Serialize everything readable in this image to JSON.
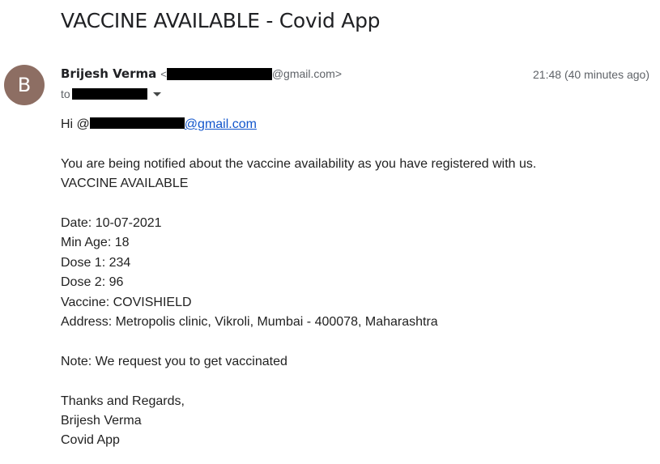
{
  "subject": "VACCINE AVAILABLE - Covid App",
  "sender": {
    "avatar_letter": "B",
    "avatar_color": "#8d6e63",
    "name": "Brijesh Verma",
    "email_open": "<",
    "email_visible_suffix": "@gmail.com>",
    "timestamp": "21:48 (40 minutes ago)",
    "to_label": "to",
    "details_icon": "chevron-down-icon"
  },
  "body": {
    "greeting_prefix": "Hi @",
    "greeting_link_suffix": "@gmail.com",
    "intro": "You are being notified about the vaccine availability as you have registered with us.",
    "heading": "VACCINE AVAILABLE",
    "date": "Date: 10-07-2021",
    "min_age": "Min Age: 18",
    "dose1": "Dose 1: 234",
    "dose2": "Dose 2: 96",
    "vaccine": "Vaccine: COVISHIELD",
    "address": "Address: Metropolis clinic, Vikroli, Mumbai - 400078, Maharashtra",
    "note": "Note: We request you to get vaccinated",
    "closing": "Thanks and Regards,",
    "signature_name": "Brijesh Verma",
    "signature_app": "Covid App"
  },
  "colors": {
    "link": "#1155cc",
    "secondary_text": "#5f6368",
    "redaction": "#000000"
  }
}
